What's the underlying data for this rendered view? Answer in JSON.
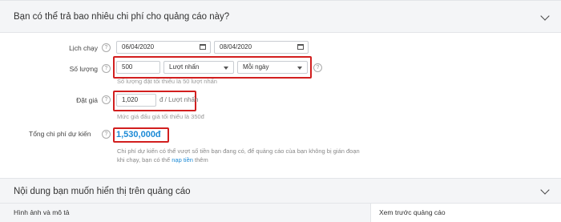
{
  "budget_section": {
    "title": "Bạn có thể trả bao nhiêu chi phí cho quảng cáo này?",
    "schedule": {
      "label": "Lịch chạy",
      "start_date": "06/04/2020",
      "end_date": "08/04/2020"
    },
    "quantity": {
      "label": "Số lượng",
      "value": "500",
      "unit": "Lượt nhấn",
      "period": "Mỗi ngày",
      "hint": "Số lượng đặt tối thiểu là 50 lượt nhấn"
    },
    "bid": {
      "label": "Đặt giá",
      "value": "1,020",
      "unit": "đ / Lượt nhấn",
      "hint": "Mức giá đấu giá tối thiểu là 350đ"
    },
    "total": {
      "label": "Tổng chi phí dự kiến",
      "value": "1,530,000đ"
    },
    "warning_line1": "Chi phí dự kiến có thể vượt số tiền bạn đang có, để quảng cáo của bạn không bị gián đoạn",
    "warning_line2_prefix": "khi chạy, bạn có thể ",
    "warning_link": "nạp tiền",
    "warning_line2_suffix": " thêm"
  },
  "content_section": {
    "title": "Nội dung bạn muốn hiển thị trên quảng cáo",
    "images_label": "Hình ảnh và mô tả",
    "preview_label": "Xem trước quảng cáo"
  },
  "help_icon_glyph": "?",
  "colors": {
    "accent": "#1c8ad6",
    "highlight": "#d21f1f"
  }
}
